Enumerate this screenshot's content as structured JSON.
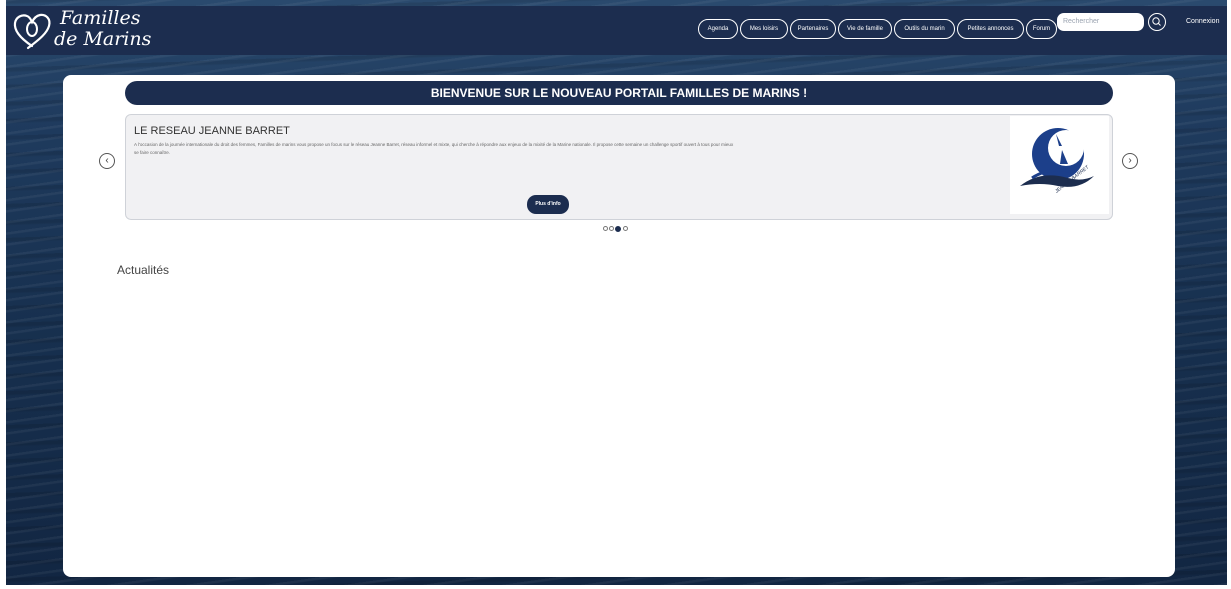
{
  "header": {
    "logo_line1": "Familles",
    "logo_line2": "de Marins",
    "nav": [
      {
        "label": "Agenda",
        "name": "nav-agenda"
      },
      {
        "label": "Mes loisirs",
        "name": "nav-mes-loisirs"
      },
      {
        "label": "Partenaires",
        "name": "nav-partenaires"
      },
      {
        "label": "Vie de famille",
        "name": "nav-vie-de-famille"
      },
      {
        "label": "Outils du marin",
        "name": "nav-outils-du-marin"
      },
      {
        "label": "Petites annonces",
        "name": "nav-petites-annonces"
      },
      {
        "label": "Forum",
        "name": "nav-forum"
      }
    ],
    "search_placeholder": "Rechercher",
    "connexion_label": "Connexion"
  },
  "banner": {
    "text": "BIENVENUE SUR LE NOUVEAU PORTAIL FAMILLES DE MARINS !"
  },
  "carousel": {
    "title": "LE RESEAU JEANNE BARRET",
    "text": "A l'occasion de la journée internationale du droit des femmes, Familles de marins vous propose un focus sur le réseau Jeanne Barret, réseau informel et mixte, qui cherche à répondre aux enjeux de la mixité de la Marine nationale. Il propose cette semaine un challenge sportif ouvert à tous pour mieux se faire connaître.",
    "more_label": "Plus d'info",
    "image_caption": "JEANNE BARRET",
    "prev_icon": "chevron-left-icon",
    "next_icon": "chevron-right-icon",
    "slide_count": 4,
    "active_slide": 3
  },
  "main": {
    "section_title": "Actualités"
  },
  "colors": {
    "navy": "#1c2d4f",
    "panel": "#ffffff",
    "card_bg": "#f1f1f3"
  }
}
